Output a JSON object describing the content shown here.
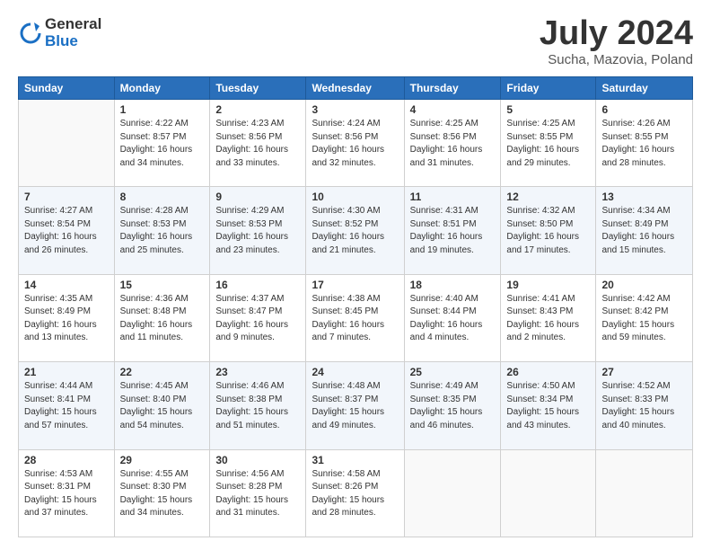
{
  "logo": {
    "general": "General",
    "blue": "Blue"
  },
  "title": "July 2024",
  "location": "Sucha, Mazovia, Poland",
  "days_of_week": [
    "Sunday",
    "Monday",
    "Tuesday",
    "Wednesday",
    "Thursday",
    "Friday",
    "Saturday"
  ],
  "weeks": [
    [
      {
        "day": null
      },
      {
        "day": "1",
        "sunrise": "4:22 AM",
        "sunset": "8:57 PM",
        "daylight": "16 hours and 34 minutes."
      },
      {
        "day": "2",
        "sunrise": "4:23 AM",
        "sunset": "8:56 PM",
        "daylight": "16 hours and 33 minutes."
      },
      {
        "day": "3",
        "sunrise": "4:24 AM",
        "sunset": "8:56 PM",
        "daylight": "16 hours and 32 minutes."
      },
      {
        "day": "4",
        "sunrise": "4:25 AM",
        "sunset": "8:56 PM",
        "daylight": "16 hours and 31 minutes."
      },
      {
        "day": "5",
        "sunrise": "4:25 AM",
        "sunset": "8:55 PM",
        "daylight": "16 hours and 29 minutes."
      },
      {
        "day": "6",
        "sunrise": "4:26 AM",
        "sunset": "8:55 PM",
        "daylight": "16 hours and 28 minutes."
      }
    ],
    [
      {
        "day": "7",
        "sunrise": "4:27 AM",
        "sunset": "8:54 PM",
        "daylight": "16 hours and 26 minutes."
      },
      {
        "day": "8",
        "sunrise": "4:28 AM",
        "sunset": "8:53 PM",
        "daylight": "16 hours and 25 minutes."
      },
      {
        "day": "9",
        "sunrise": "4:29 AM",
        "sunset": "8:53 PM",
        "daylight": "16 hours and 23 minutes."
      },
      {
        "day": "10",
        "sunrise": "4:30 AM",
        "sunset": "8:52 PM",
        "daylight": "16 hours and 21 minutes."
      },
      {
        "day": "11",
        "sunrise": "4:31 AM",
        "sunset": "8:51 PM",
        "daylight": "16 hours and 19 minutes."
      },
      {
        "day": "12",
        "sunrise": "4:32 AM",
        "sunset": "8:50 PM",
        "daylight": "16 hours and 17 minutes."
      },
      {
        "day": "13",
        "sunrise": "4:34 AM",
        "sunset": "8:49 PM",
        "daylight": "16 hours and 15 minutes."
      }
    ],
    [
      {
        "day": "14",
        "sunrise": "4:35 AM",
        "sunset": "8:49 PM",
        "daylight": "16 hours and 13 minutes."
      },
      {
        "day": "15",
        "sunrise": "4:36 AM",
        "sunset": "8:48 PM",
        "daylight": "16 hours and 11 minutes."
      },
      {
        "day": "16",
        "sunrise": "4:37 AM",
        "sunset": "8:47 PM",
        "daylight": "16 hours and 9 minutes."
      },
      {
        "day": "17",
        "sunrise": "4:38 AM",
        "sunset": "8:45 PM",
        "daylight": "16 hours and 7 minutes."
      },
      {
        "day": "18",
        "sunrise": "4:40 AM",
        "sunset": "8:44 PM",
        "daylight": "16 hours and 4 minutes."
      },
      {
        "day": "19",
        "sunrise": "4:41 AM",
        "sunset": "8:43 PM",
        "daylight": "16 hours and 2 minutes."
      },
      {
        "day": "20",
        "sunrise": "4:42 AM",
        "sunset": "8:42 PM",
        "daylight": "15 hours and 59 minutes."
      }
    ],
    [
      {
        "day": "21",
        "sunrise": "4:44 AM",
        "sunset": "8:41 PM",
        "daylight": "15 hours and 57 minutes."
      },
      {
        "day": "22",
        "sunrise": "4:45 AM",
        "sunset": "8:40 PM",
        "daylight": "15 hours and 54 minutes."
      },
      {
        "day": "23",
        "sunrise": "4:46 AM",
        "sunset": "8:38 PM",
        "daylight": "15 hours and 51 minutes."
      },
      {
        "day": "24",
        "sunrise": "4:48 AM",
        "sunset": "8:37 PM",
        "daylight": "15 hours and 49 minutes."
      },
      {
        "day": "25",
        "sunrise": "4:49 AM",
        "sunset": "8:35 PM",
        "daylight": "15 hours and 46 minutes."
      },
      {
        "day": "26",
        "sunrise": "4:50 AM",
        "sunset": "8:34 PM",
        "daylight": "15 hours and 43 minutes."
      },
      {
        "day": "27",
        "sunrise": "4:52 AM",
        "sunset": "8:33 PM",
        "daylight": "15 hours and 40 minutes."
      }
    ],
    [
      {
        "day": "28",
        "sunrise": "4:53 AM",
        "sunset": "8:31 PM",
        "daylight": "15 hours and 37 minutes."
      },
      {
        "day": "29",
        "sunrise": "4:55 AM",
        "sunset": "8:30 PM",
        "daylight": "15 hours and 34 minutes."
      },
      {
        "day": "30",
        "sunrise": "4:56 AM",
        "sunset": "8:28 PM",
        "daylight": "15 hours and 31 minutes."
      },
      {
        "day": "31",
        "sunrise": "4:58 AM",
        "sunset": "8:26 PM",
        "daylight": "15 hours and 28 minutes."
      },
      {
        "day": null
      },
      {
        "day": null
      },
      {
        "day": null
      }
    ]
  ]
}
